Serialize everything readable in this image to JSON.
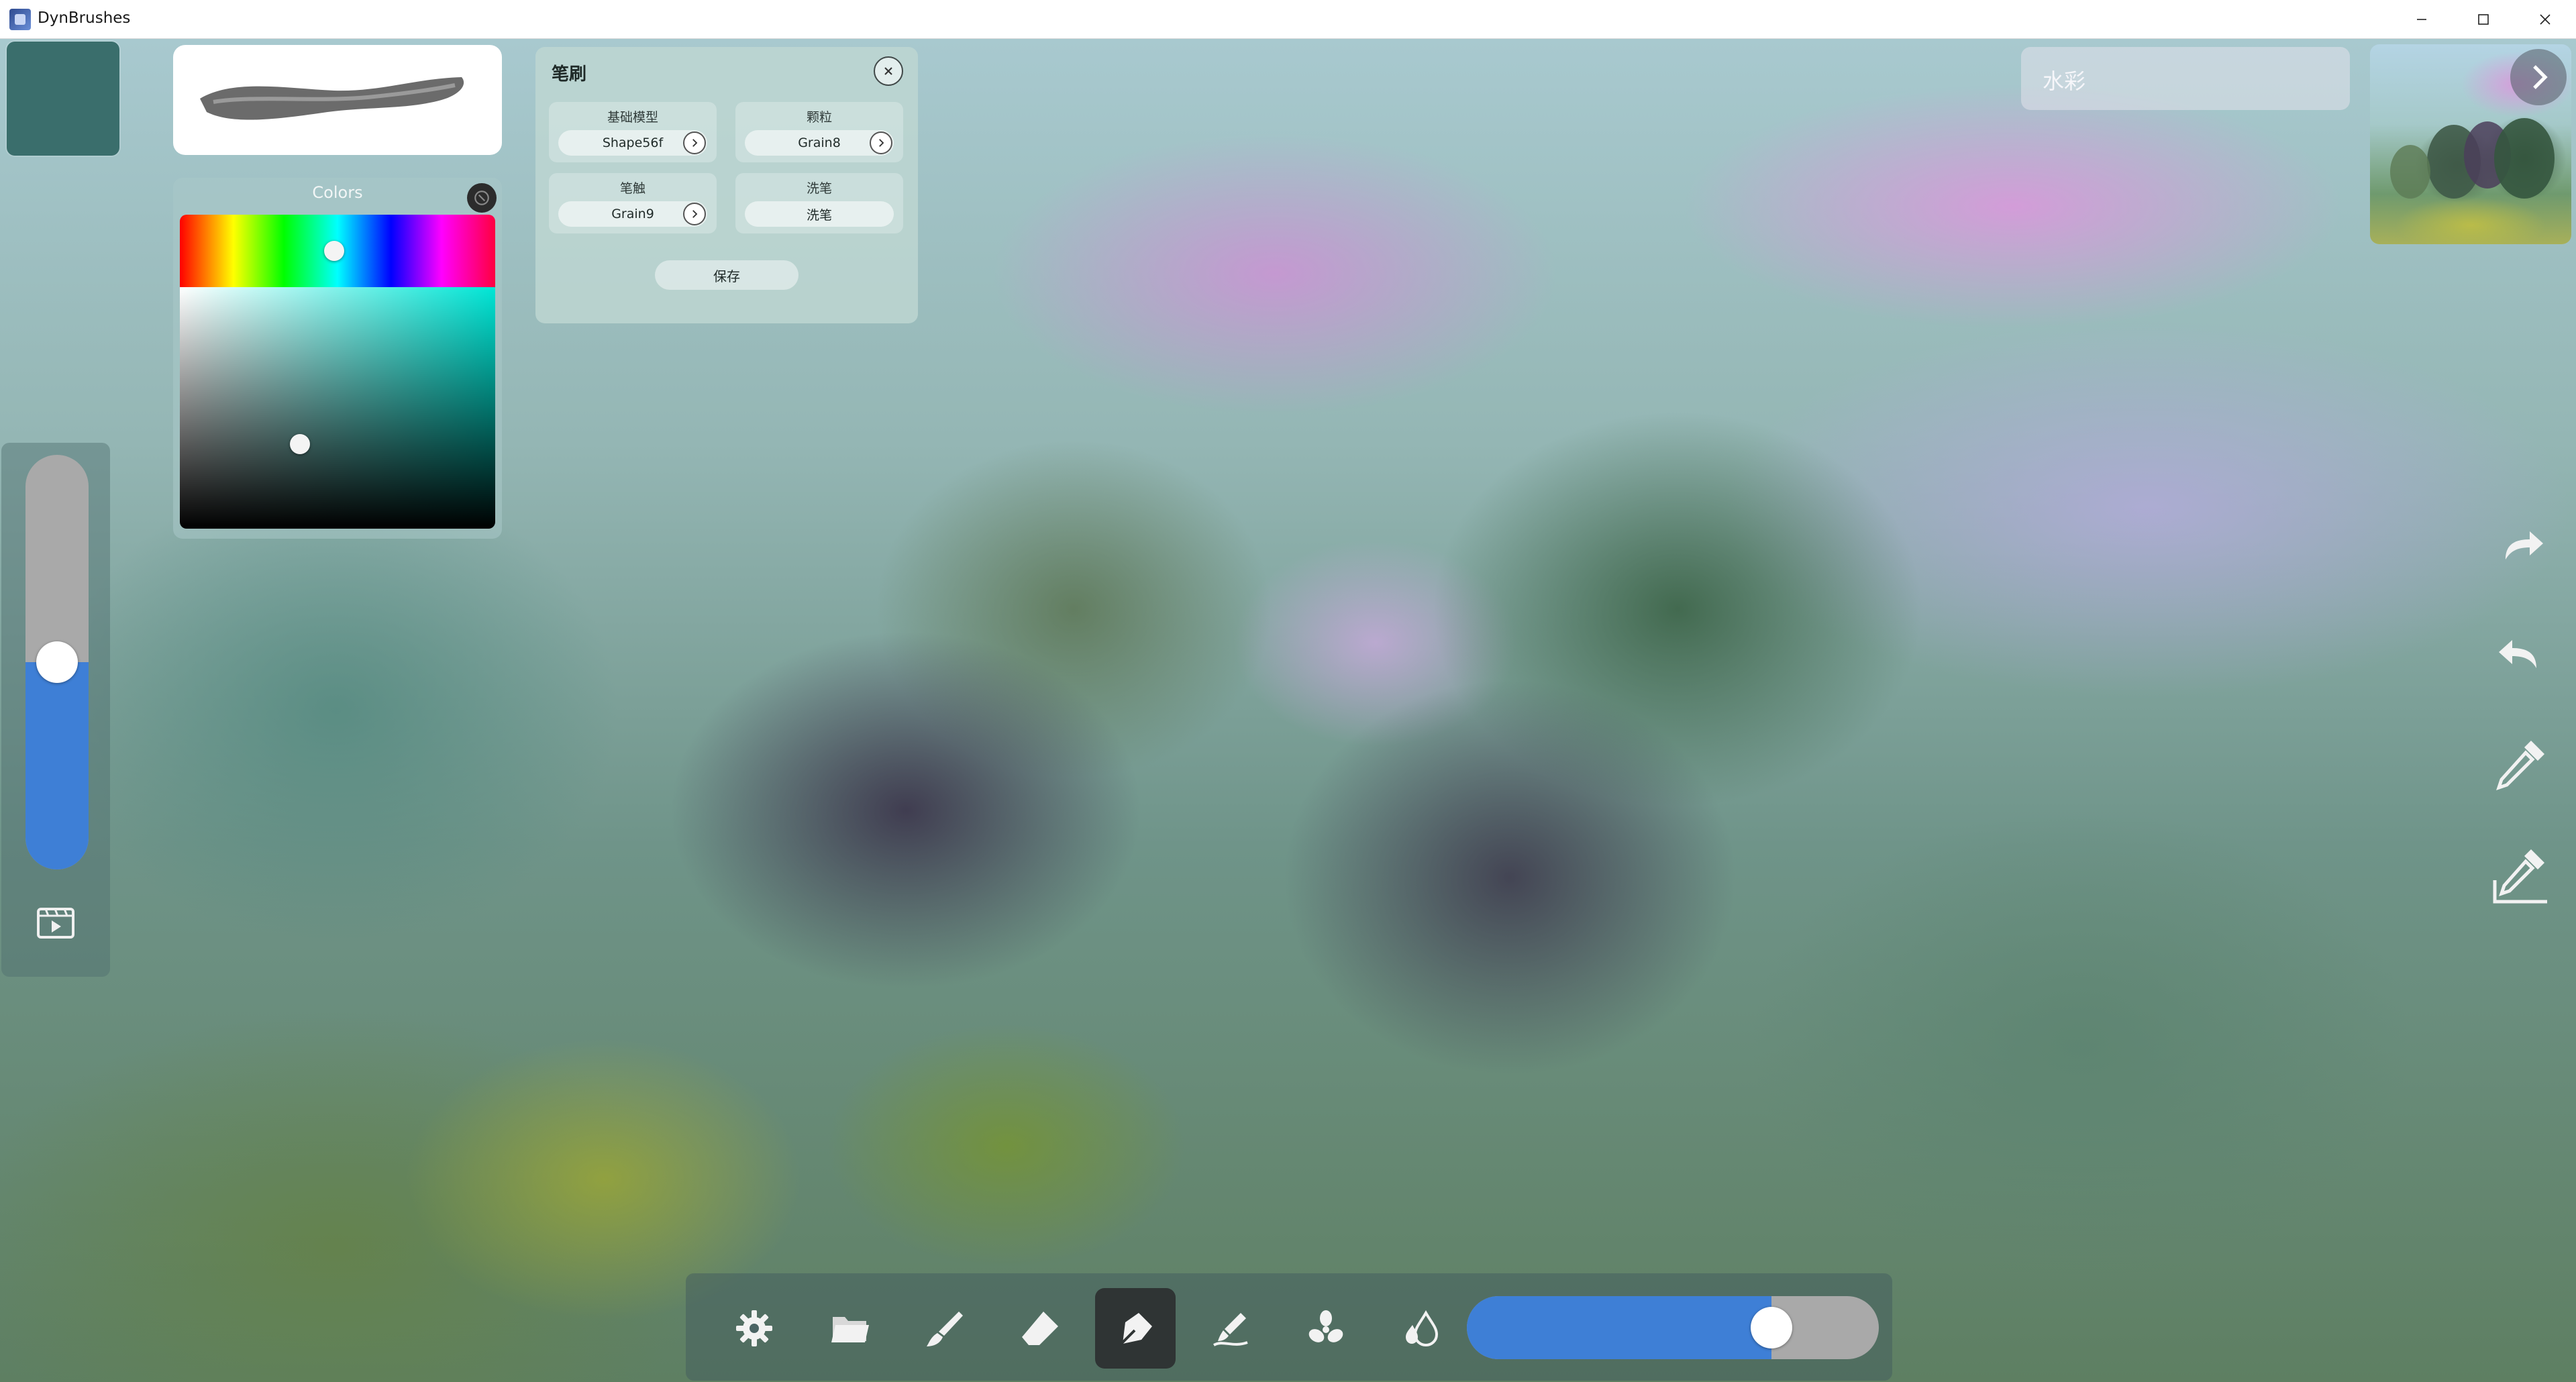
{
  "window": {
    "title": "DynBrushes",
    "minimize_icon": "minimize-icon",
    "maximize_icon": "maximize-icon",
    "close_icon": "close-icon"
  },
  "current_color": "#3a6e6c",
  "colors_panel": {
    "title": "Colors",
    "hue_position": 0.49,
    "saturation": 0.38,
    "value": 0.35
  },
  "brush_panel": {
    "title": "笔刷",
    "cells": [
      {
        "label": "基础模型",
        "value": "Shape56f",
        "has_arrow": true
      },
      {
        "label": "颗粒",
        "value": "Grain8",
        "has_arrow": true
      },
      {
        "label": "笔触",
        "value": "Grain9",
        "has_arrow": true
      },
      {
        "label": "洗笔",
        "value": "洗笔",
        "has_arrow": false
      }
    ],
    "save_label": "保存"
  },
  "brush_name": {
    "placeholder": "水彩"
  },
  "size_slider": {
    "level": 0.5,
    "record_icon": "film-icon"
  },
  "right_tools": [
    "redo-icon",
    "undo-icon",
    "eyedropper-icon",
    "eyedropper-canvas-icon"
  ],
  "toolbar": {
    "tools": [
      "gear-icon",
      "folder-icon",
      "brush-icon",
      "eraser-icon",
      "smudge-icon",
      "blend-icon",
      "fan-icon",
      "water-drop-icon"
    ],
    "active_tool": "smudge-icon",
    "opacity": 0.74
  },
  "accent": "#3e7fd6"
}
